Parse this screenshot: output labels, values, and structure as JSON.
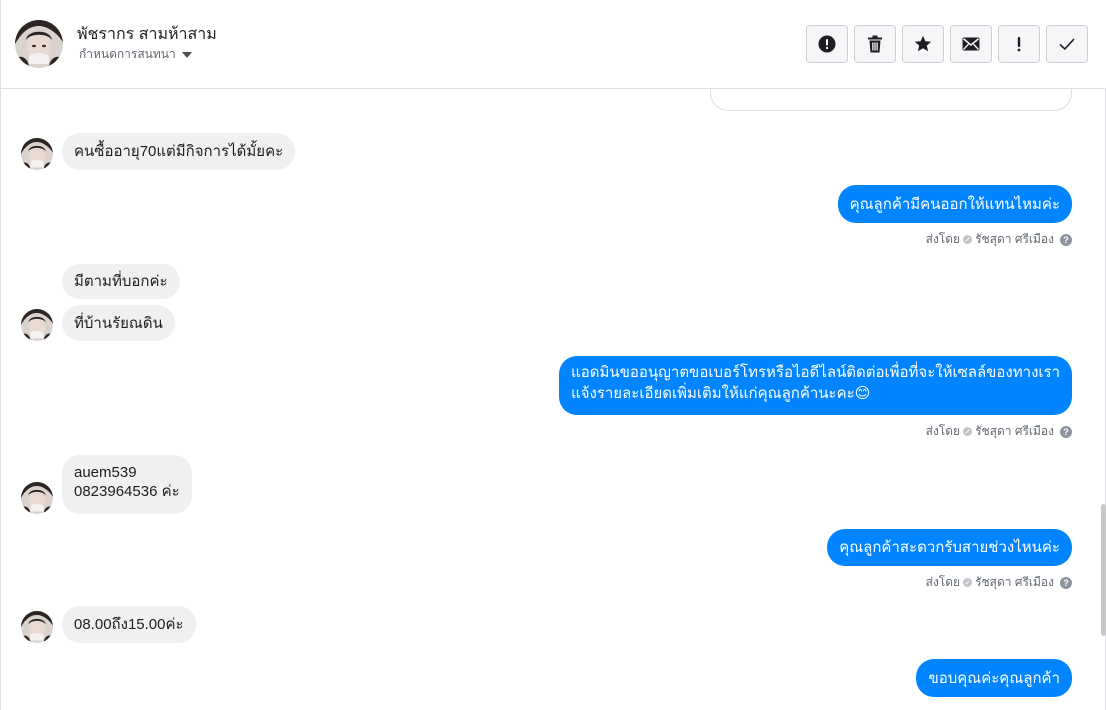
{
  "header": {
    "contact_name": "พัชรากร สามห้าสาม",
    "conversation_menu_label": "กำหนดการสนทนา",
    "actions": [
      {
        "name": "report-spam-button",
        "icon": "exclamation-circle-icon"
      },
      {
        "name": "delete-button",
        "icon": "trash-icon"
      },
      {
        "name": "star-button",
        "icon": "star-icon"
      },
      {
        "name": "mark-unread-button",
        "icon": "envelope-icon"
      },
      {
        "name": "mark-important-button",
        "icon": "exclamation-icon"
      },
      {
        "name": "mark-done-button",
        "icon": "checkmark-icon"
      }
    ]
  },
  "messages": {
    "m1": "คนซื้ออายุ70แต่มีกิจการได้มั้ยคะ",
    "m2": "คุณลูกค้ามีคนออกให้แทนไหมค่ะ",
    "m3": "มีตามที่บอกค่ะ",
    "m4": "ที่บ้านรัยณดิน",
    "m5_line1": "แอดมินขออนุญาตขอเบอร์โทรหรือไอดีไลน์ติดต่อเพื่อที่จะให้เซลล์ของทางเรา",
    "m5_line2": "แจ้งรายละเอียดเพิ่มเติมให้แก่คุณลูกค้านะคะ😊",
    "m6_line1": "auem539",
    "m6_line2": "0823964536 ค่ะ",
    "m7": "คุณลูกค้าสะดวกรับสายช่วงไหนค่ะ",
    "m8": "08.00ถึง15.00ค่ะ",
    "m9": "ขอบคุณค่ะคุณลูกค้า"
  },
  "sent_by": {
    "label": "ส่งโดย",
    "agent": "รัชสุดา ศรีเมือง",
    "help": "?"
  },
  "colors": {
    "outgoing_bubble": "#0084ff",
    "incoming_bubble": "#f0f0f0"
  }
}
